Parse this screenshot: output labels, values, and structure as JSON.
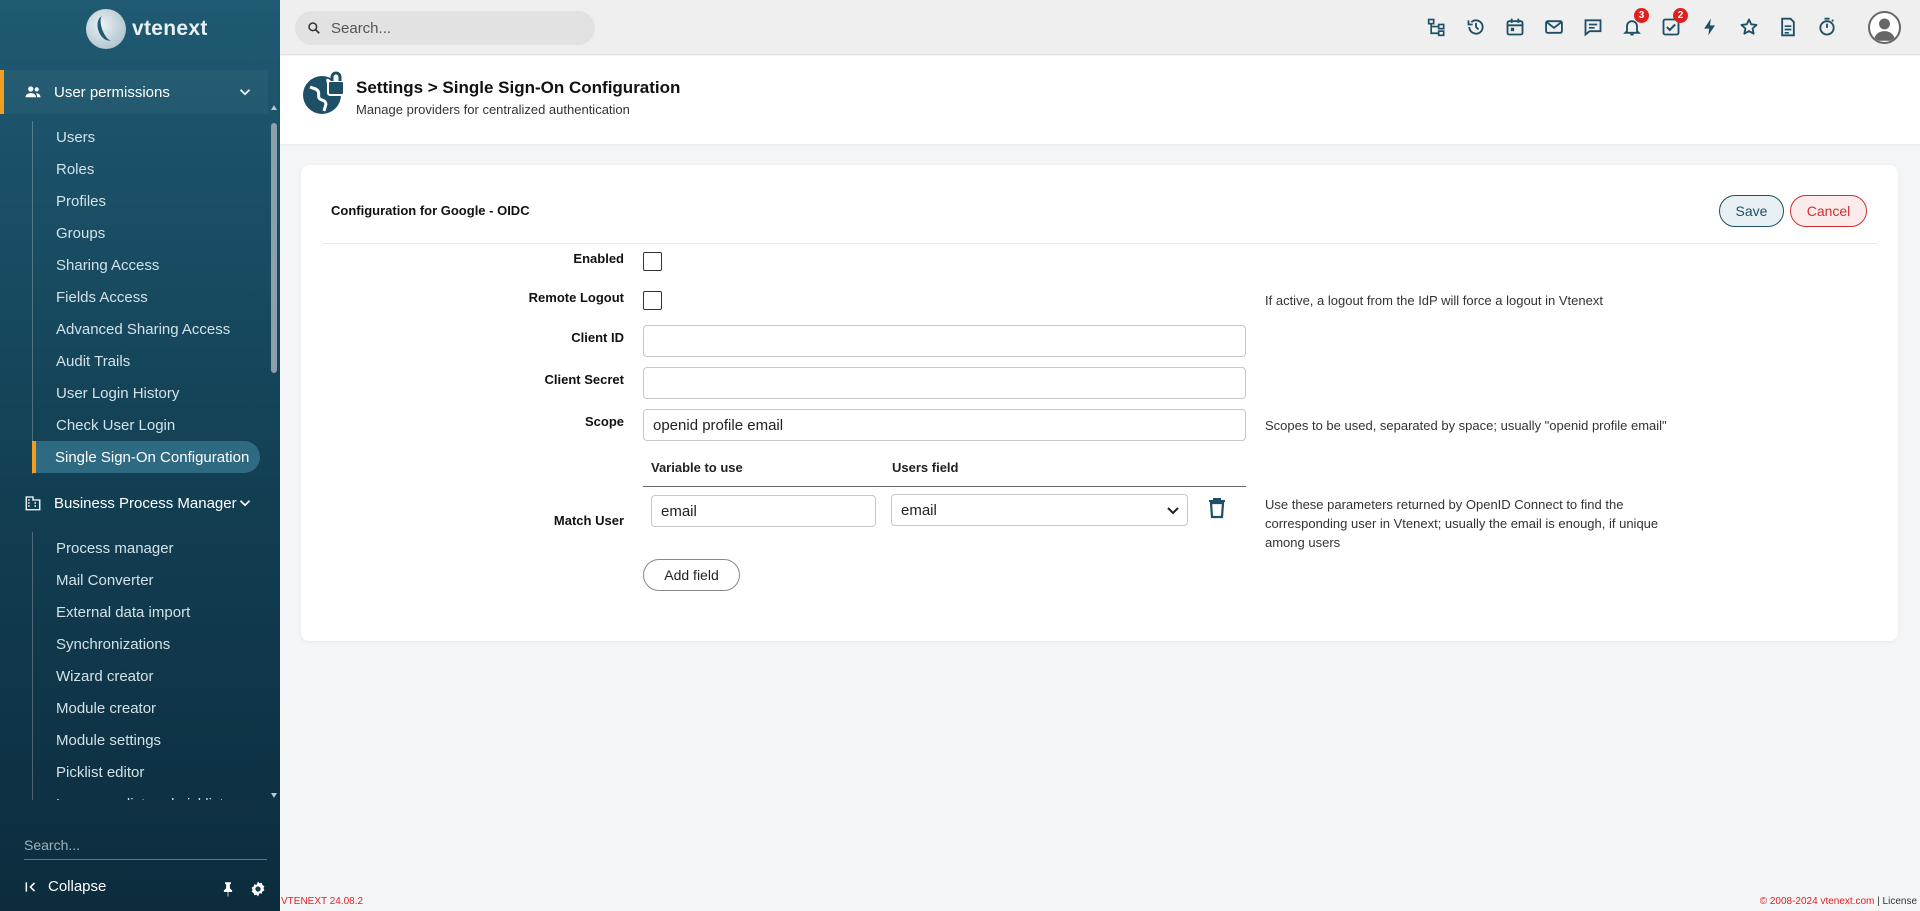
{
  "app": {
    "logo_text": "vtenext"
  },
  "topbar": {
    "search_placeholder": "Search...",
    "notifications_badge": "3",
    "tasks_badge": "2"
  },
  "sidebar": {
    "section1": {
      "label": "User permissions",
      "icon": "users-icon"
    },
    "items1": [
      {
        "label": "Users"
      },
      {
        "label": "Roles"
      },
      {
        "label": "Profiles"
      },
      {
        "label": "Groups"
      },
      {
        "label": "Sharing Access"
      },
      {
        "label": "Fields Access"
      },
      {
        "label": "Advanced Sharing Access"
      },
      {
        "label": "Audit Trails"
      },
      {
        "label": "User Login History"
      },
      {
        "label": "Check User Login"
      },
      {
        "label": "Single Sign-On Configuration",
        "active": true
      }
    ],
    "section2": {
      "label": "Business Process Manager",
      "icon": "building-icon"
    },
    "items2": [
      {
        "label": "Process manager"
      },
      {
        "label": "Mail Converter"
      },
      {
        "label": "External data import"
      },
      {
        "label": "Synchronizations"
      },
      {
        "label": "Wizard creator"
      },
      {
        "label": "Module creator"
      },
      {
        "label": "Module settings"
      },
      {
        "label": "Picklist editor"
      },
      {
        "label": "Language list and picklist"
      }
    ],
    "search_placeholder": "Search...",
    "collapse_label": "Collapse"
  },
  "header": {
    "title": "Settings > Single Sign-On Configuration",
    "subtitle": "Manage providers for centralized authentication"
  },
  "form": {
    "title": "Configuration for Google - OIDC",
    "save_label": "Save",
    "cancel_label": "Cancel",
    "enabled": {
      "label": "Enabled",
      "checked": false
    },
    "remote_logout": {
      "label": "Remote Logout",
      "checked": false,
      "help": "If active, a logout from the IdP will force a logout in Vtenext"
    },
    "client_id": {
      "label": "Client ID",
      "value": ""
    },
    "client_secret": {
      "label": "Client Secret",
      "value": ""
    },
    "scope": {
      "label": "Scope",
      "value": "openid profile email",
      "help": "Scopes to be used, separated by space; usually \"openid profile email\""
    },
    "match_user": {
      "label": "Match User",
      "col_variable": "Variable to use",
      "col_users_field": "Users field",
      "variable_value": "email",
      "users_field_value": "email",
      "help": "Use these parameters returned by OpenID Connect to find the corresponding user in Vtenext; usually the email is enough, if unique among users",
      "add_field_label": "Add field"
    }
  },
  "footer": {
    "version": "VTENEXT 24.08.2",
    "copyright": "© 2008-2024 vtenext.com",
    "separator": " | ",
    "license": "License"
  },
  "colors": {
    "accent": "#f0a020",
    "primary": "#1d4f66",
    "danger": "#d03030",
    "badge": "#e02020"
  }
}
